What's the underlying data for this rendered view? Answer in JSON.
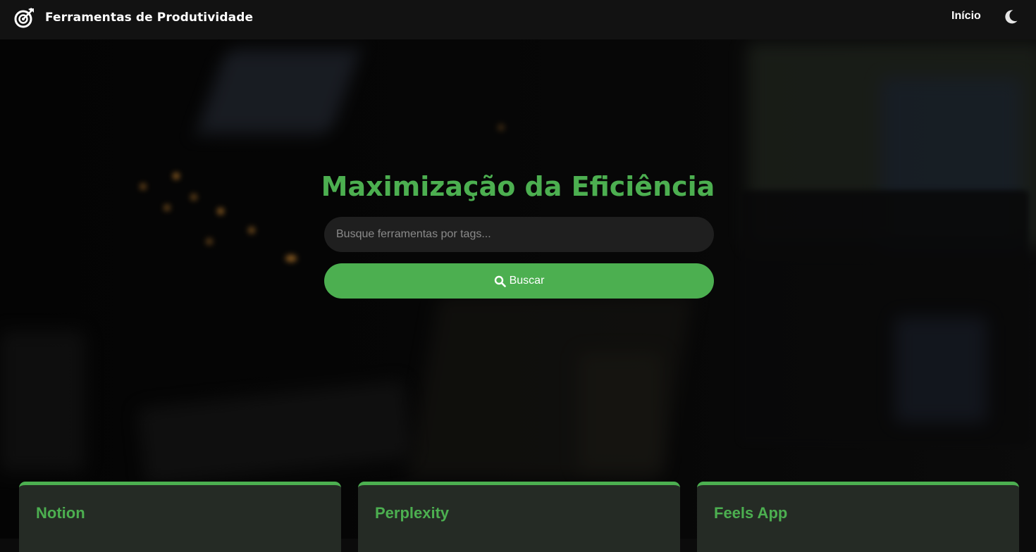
{
  "header": {
    "brand_title": "Ferramentas de Produtividade",
    "brand_icon": "target-arrow-icon",
    "nav": {
      "home_label": "Início"
    },
    "theme_toggle_icon": "moon-icon"
  },
  "hero": {
    "title": "Maximização da Eficiência",
    "search": {
      "placeholder": "Busque ferramentas por tags...",
      "value": ""
    },
    "search_button": {
      "label": "Buscar",
      "icon": "search-icon"
    }
  },
  "cards": [
    {
      "title": "Notion"
    },
    {
      "title": "Perplexity"
    },
    {
      "title": "Feels App"
    }
  ],
  "colors": {
    "accent": "#4caf50",
    "header_bg": "#121212",
    "card_bg": "#252b25",
    "input_bg": "#1f1f1f"
  }
}
